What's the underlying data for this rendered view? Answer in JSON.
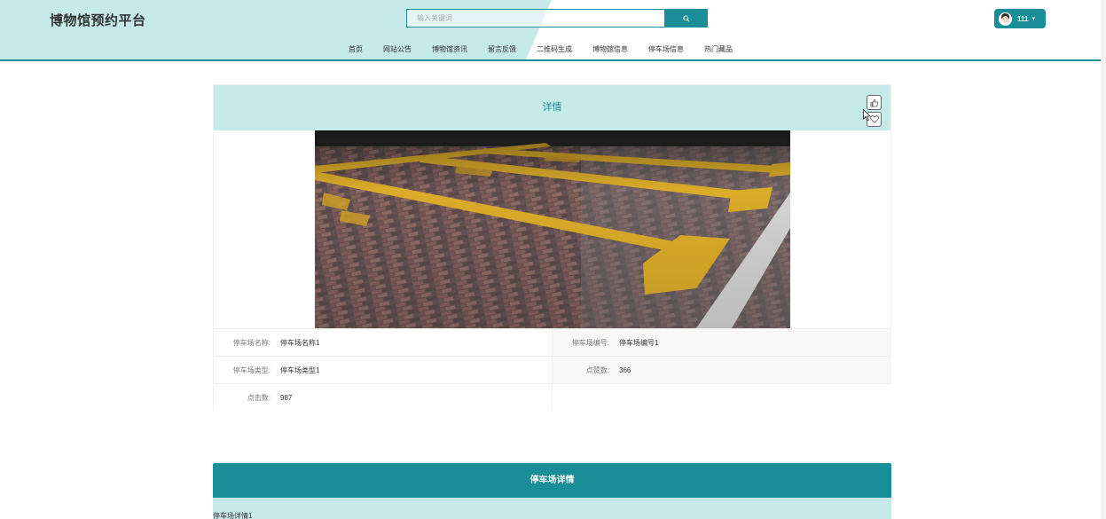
{
  "header": {
    "logo": "博物馆预约平台",
    "search_placeholder": "输入关键词",
    "user_name": "111",
    "nav": [
      "首页",
      "网站公告",
      "博物馆资讯",
      "留言反馈",
      "二维码生成",
      "博物馆信息",
      "停车场信息",
      "热门藏品"
    ]
  },
  "detail": {
    "title": "详情",
    "fields": {
      "name_label": "停车场名称:",
      "name_value": "停车场名称1",
      "number_label": "停车场编号:",
      "number_value": "停车场编号1",
      "type_label": "停车场类型:",
      "type_value": "停车场类型1",
      "likes_label": "点赞数:",
      "likes_value": "366",
      "clicks_label": "点击数:",
      "clicks_value": "987"
    }
  },
  "section": {
    "title": "停车场详情",
    "body": "停车场详情1"
  },
  "colors": {
    "accent": "#1a8e96",
    "accent_light": "#c6e9ea"
  },
  "icons": [
    "search-icon",
    "like-icon",
    "favorite-icon",
    "caret-down-icon"
  ]
}
